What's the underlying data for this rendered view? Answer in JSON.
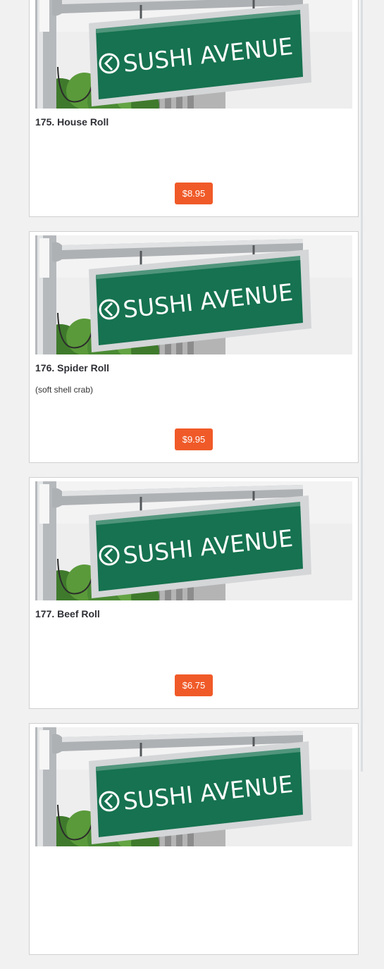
{
  "brand": {
    "sign_text": "SUSHI AVENUE"
  },
  "colors": {
    "price_button": "#f05a28",
    "sign_green": "#167250",
    "card_border": "#d0d0d0",
    "page_background": "#f1f1f2"
  },
  "items": [
    {
      "title": "175. House Roll",
      "description": "",
      "price": "$8.95"
    },
    {
      "title": "176. Spider Roll",
      "description": "(soft shell crab)",
      "price": "$9.95"
    },
    {
      "title": "177. Beef Roll",
      "description": "",
      "price": "$6.75"
    },
    {
      "title": "",
      "description": "",
      "price": ""
    }
  ]
}
